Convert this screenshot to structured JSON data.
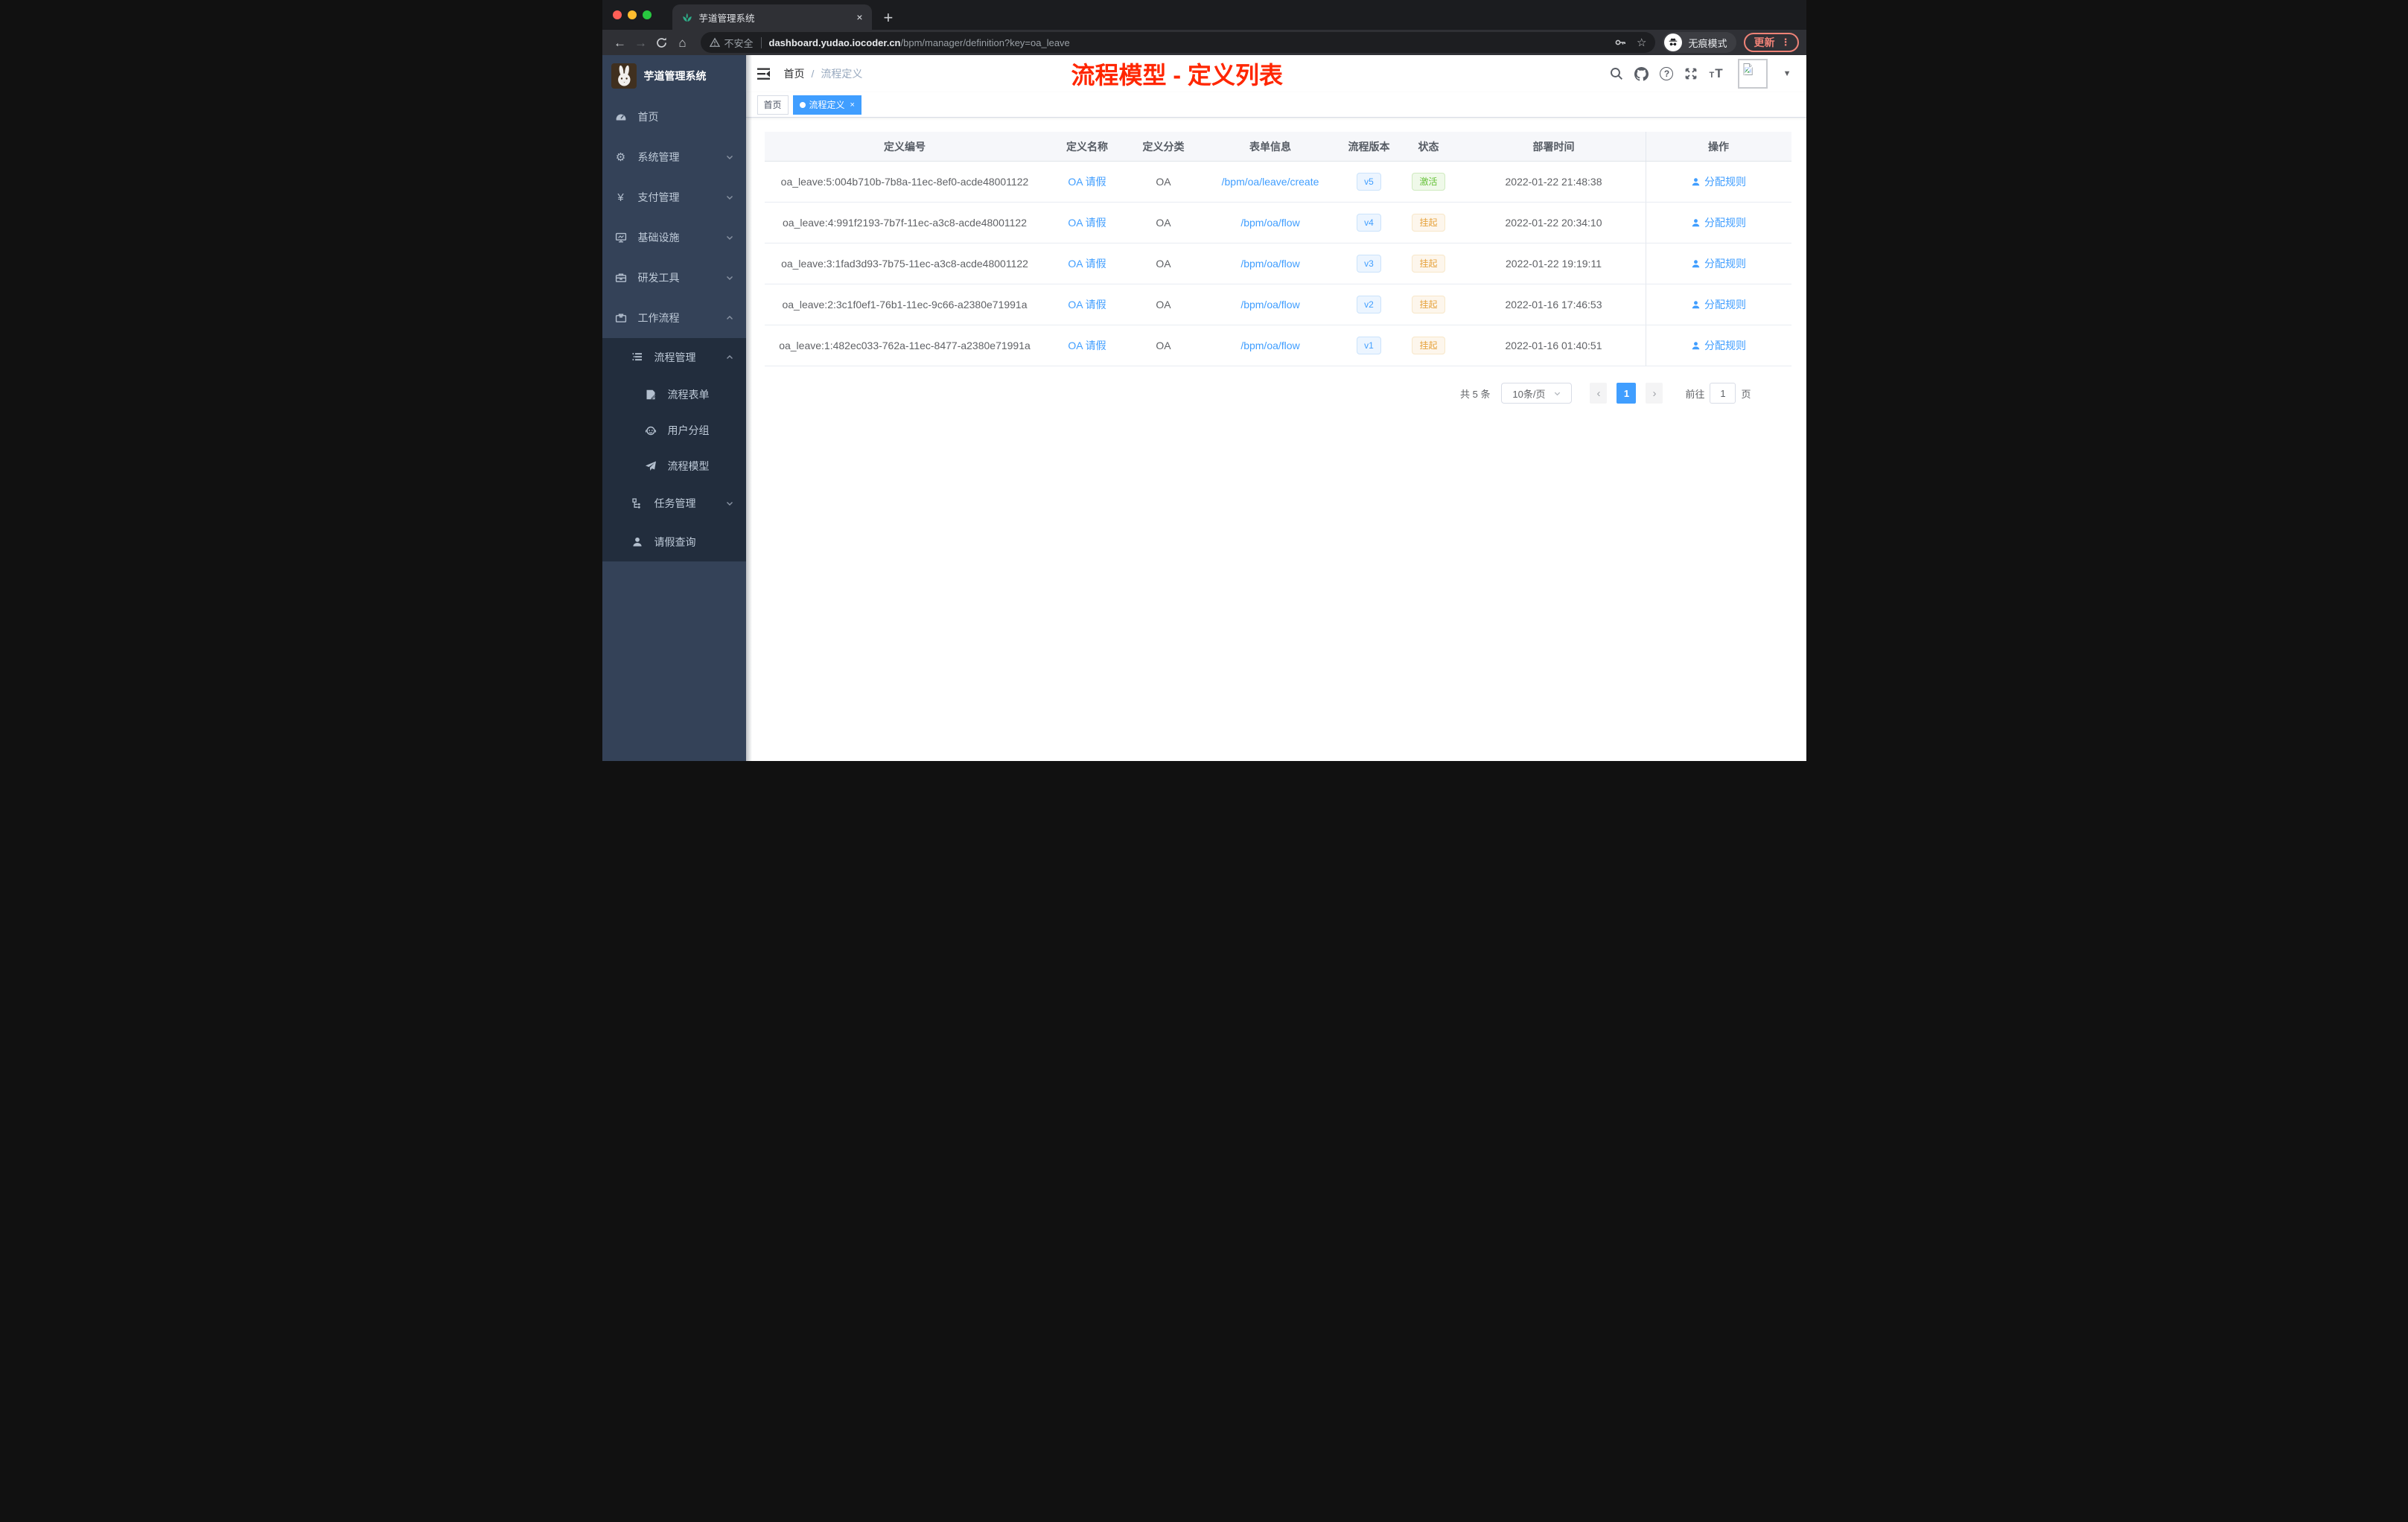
{
  "browser": {
    "tab_title": "芋道管理系统",
    "security": "不安全",
    "url_domain": "dashboard.yudao.iocoder.cn",
    "url_path": "/bpm/manager/definition?key=oa_leave",
    "incognito": "无痕模式",
    "update": "更新"
  },
  "icons": {
    "close": "×",
    "plus": "+",
    "back": "←",
    "forward": "→",
    "home": "⌂",
    "star": "☆",
    "dots": "⋮",
    "caret_down": "▼",
    "prev": "‹",
    "next": "›",
    "gear": "⚙",
    "yen": "¥",
    "question": "?",
    "font_small": "T",
    "font_large": "T"
  },
  "sidebar": {
    "logo_title": "芋道管理系统",
    "items": [
      {
        "label": "首页"
      },
      {
        "label": "系统管理"
      },
      {
        "label": "支付管理"
      },
      {
        "label": "基础设施"
      },
      {
        "label": "研发工具"
      },
      {
        "label": "工作流程"
      }
    ],
    "sub": {
      "manage": "流程管理",
      "children": [
        {
          "label": "流程表单"
        },
        {
          "label": "用户分组"
        },
        {
          "label": "流程模型"
        }
      ],
      "task": "任务管理",
      "leave": "请假查询"
    }
  },
  "navbar": {
    "breadcrumb_home": "首页",
    "breadcrumb_sep": "/",
    "breadcrumb_current": "流程定义",
    "annotation": "流程模型 - 定义列表"
  },
  "tags": {
    "home": "首页",
    "current": "流程定义"
  },
  "table": {
    "columns": [
      "定义编号",
      "定义名称",
      "定义分类",
      "表单信息",
      "流程版本",
      "状态",
      "部署时间",
      "操作"
    ],
    "rows": [
      {
        "id": "oa_leave:5:004b710b-7b8a-11ec-8ef0-acde48001122",
        "name": "OA 请假",
        "category": "OA",
        "form": "/bpm/oa/leave/create",
        "version": "v5",
        "status": "激活",
        "time": "2022-01-22 21:48:38",
        "action": "分配规则"
      },
      {
        "id": "oa_leave:4:991f2193-7b7f-11ec-a3c8-acde48001122",
        "name": "OA 请假",
        "category": "OA",
        "form": "/bpm/oa/flow",
        "version": "v4",
        "status": "挂起",
        "time": "2022-01-22 20:34:10",
        "action": "分配规则"
      },
      {
        "id": "oa_leave:3:1fad3d93-7b75-11ec-a3c8-acde48001122",
        "name": "OA 请假",
        "category": "OA",
        "form": "/bpm/oa/flow",
        "version": "v3",
        "status": "挂起",
        "time": "2022-01-22 19:19:11",
        "action": "分配规则"
      },
      {
        "id": "oa_leave:2:3c1f0ef1-76b1-11ec-9c66-a2380e71991a",
        "name": "OA 请假",
        "category": "OA",
        "form": "/bpm/oa/flow",
        "version": "v2",
        "status": "挂起",
        "time": "2022-01-16 17:46:53",
        "action": "分配规则"
      },
      {
        "id": "oa_leave:1:482ec033-762a-11ec-8477-a2380e71991a",
        "name": "OA 请假",
        "category": "OA",
        "form": "/bpm/oa/flow",
        "version": "v1",
        "status": "挂起",
        "time": "2022-01-16 01:40:51",
        "action": "分配规则"
      }
    ]
  },
  "pagination": {
    "total": "共 5 条",
    "size": "10条/页",
    "current": "1",
    "goto": "前往",
    "goto_value": "1",
    "unit": "页"
  },
  "colors": {
    "accent": "#409eff",
    "status_active": "#67c23a",
    "status_suspended": "#e6a23c",
    "annotation_red": "#ff2600",
    "sidebar_bg": "#344258",
    "submenu_bg": "#222d3d"
  }
}
